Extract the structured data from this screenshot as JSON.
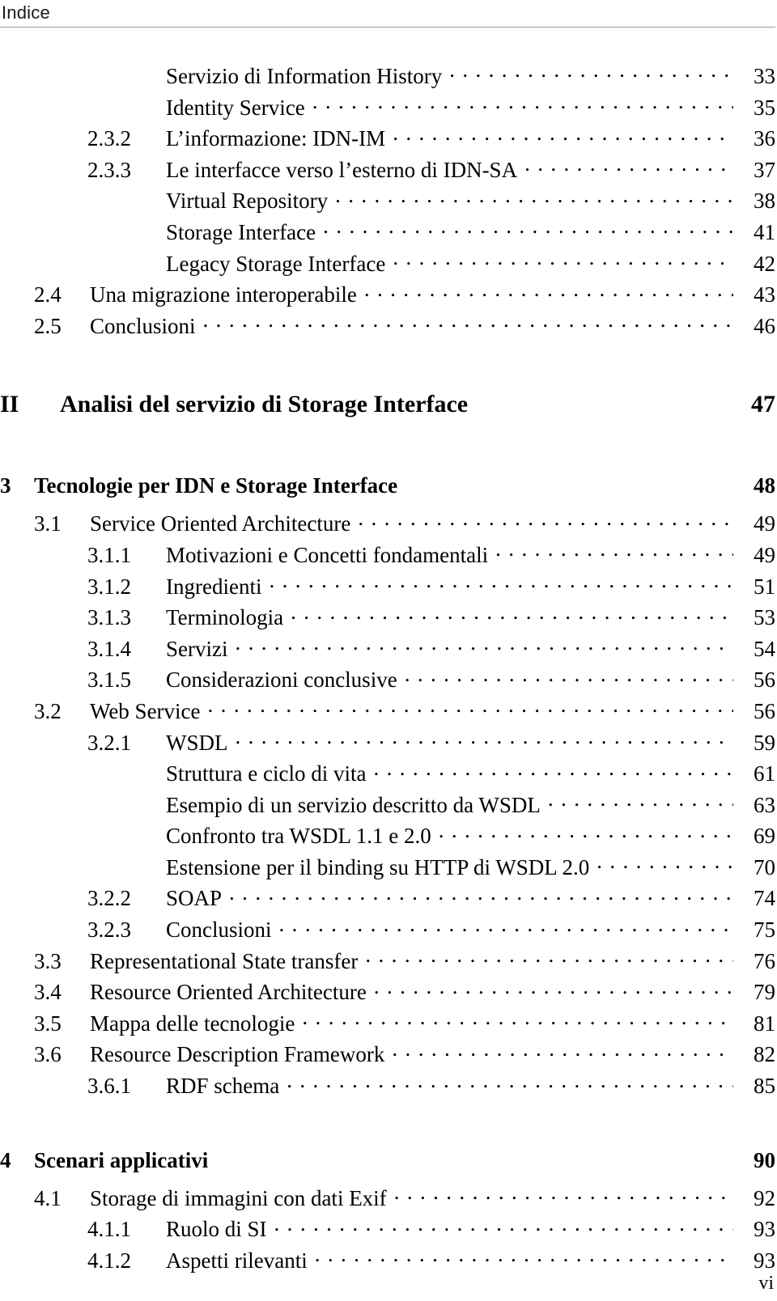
{
  "header": {
    "title": "Indice"
  },
  "folio": "vi",
  "toc": {
    "entries": [
      {
        "level": "4",
        "num": "",
        "title": "Servizio di Information History",
        "page": "33"
      },
      {
        "level": "4",
        "num": "",
        "title": "Identity Service",
        "page": "35"
      },
      {
        "level": "3",
        "num": "2.3.2",
        "title": "L’informazione: IDN-IM",
        "page": "36"
      },
      {
        "level": "3",
        "num": "2.3.3",
        "title": "Le interfacce verso l’esterno di IDN-SA",
        "page": "37"
      },
      {
        "level": "4",
        "num": "",
        "title": "Virtual Repository",
        "page": "38"
      },
      {
        "level": "4",
        "num": "",
        "title": "Storage Interface",
        "page": "41"
      },
      {
        "level": "4",
        "num": "",
        "title": "Legacy Storage Interface",
        "page": "42"
      },
      {
        "level": "2",
        "num": "2.4",
        "title": "Una migrazione interoperabile",
        "page": "43"
      },
      {
        "level": "2",
        "num": "2.5",
        "title": "Conclusioni",
        "page": "46"
      },
      {
        "level": "gap-part"
      },
      {
        "level": "part",
        "num": "II",
        "title": "Analisi del servizio di Storage Interface",
        "page": "47"
      },
      {
        "level": "gap-chap-big"
      },
      {
        "level": "chap",
        "num": "3",
        "title": "Tecnologie per IDN e Storage Interface",
        "page": "48"
      },
      {
        "level": "2",
        "num": "3.1",
        "title": "Service Oriented Architecture",
        "page": "49"
      },
      {
        "level": "3",
        "num": "3.1.1",
        "title": "Motivazioni e Concetti fondamentali",
        "page": "49"
      },
      {
        "level": "3",
        "num": "3.1.2",
        "title": "Ingredienti",
        "page": "51"
      },
      {
        "level": "3",
        "num": "3.1.3",
        "title": "Terminologia",
        "page": "53"
      },
      {
        "level": "3",
        "num": "3.1.4",
        "title": "Servizi",
        "page": "54"
      },
      {
        "level": "3",
        "num": "3.1.5",
        "title": "Considerazioni conclusive",
        "page": "56"
      },
      {
        "level": "2",
        "num": "3.2",
        "title": "Web Service",
        "page": "56"
      },
      {
        "level": "3",
        "num": "3.2.1",
        "title": "WSDL",
        "page": "59"
      },
      {
        "level": "4",
        "num": "",
        "title": "Struttura e ciclo di vita",
        "page": "61"
      },
      {
        "level": "4",
        "num": "",
        "title": "Esempio di un servizio descritto da WSDL",
        "page": "63"
      },
      {
        "level": "4",
        "num": "",
        "title": "Confronto tra WSDL 1.1 e 2.0",
        "page": "69"
      },
      {
        "level": "4",
        "num": "",
        "title": "Estensione per il binding su HTTP di WSDL 2.0",
        "page": "70"
      },
      {
        "level": "3",
        "num": "3.2.2",
        "title": "SOAP",
        "page": "74"
      },
      {
        "level": "3",
        "num": "3.2.3",
        "title": "Conclusioni",
        "page": "75"
      },
      {
        "level": "2",
        "num": "3.3",
        "title": "Representational State transfer",
        "page": "76"
      },
      {
        "level": "2",
        "num": "3.4",
        "title": "Resource Oriented Architecture",
        "page": "79"
      },
      {
        "level": "2",
        "num": "3.5",
        "title": "Mappa delle tecnologie",
        "page": "81"
      },
      {
        "level": "2",
        "num": "3.6",
        "title": "Resource Description Framework",
        "page": "82"
      },
      {
        "level": "3",
        "num": "3.6.1",
        "title": "RDF schema",
        "page": "85"
      },
      {
        "level": "gap-chap-big"
      },
      {
        "level": "chap",
        "num": "4",
        "title": "Scenari applicativi",
        "page": "90"
      },
      {
        "level": "2",
        "num": "4.1",
        "title": "Storage di immagini con dati Exif",
        "page": "92"
      },
      {
        "level": "3",
        "num": "4.1.1",
        "title": "Ruolo di SI",
        "page": "93"
      },
      {
        "level": "3",
        "num": "4.1.2",
        "title": "Aspetti rilevanti",
        "page": "93"
      }
    ]
  }
}
